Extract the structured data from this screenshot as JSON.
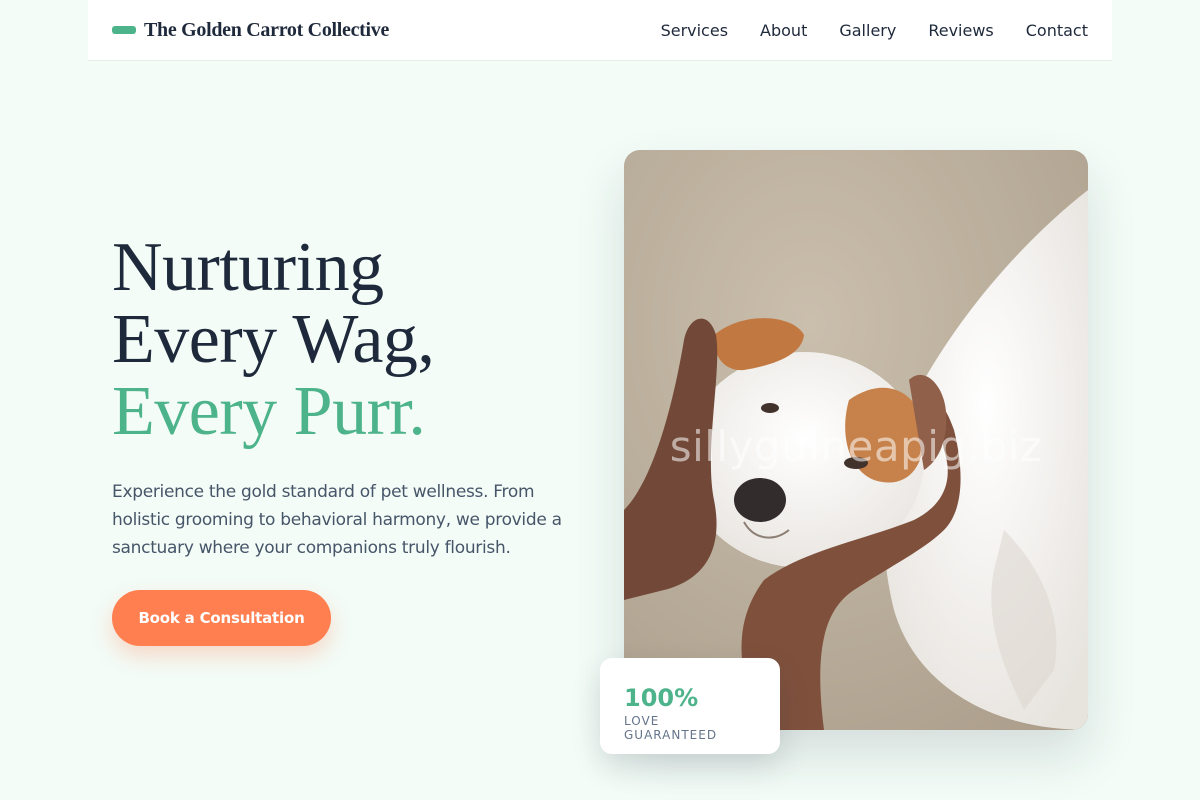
{
  "nav": {
    "brand": "The Golden Carrot Collective",
    "links": [
      "Services",
      "About",
      "Gallery",
      "Reviews",
      "Contact"
    ]
  },
  "hero": {
    "headline_line1": "Nurturing",
    "headline_line2": "Every Wag,",
    "headline_accent": "Every Purr.",
    "lede": "Experience the gold standard of pet wellness. From holistic grooming to behavioral harmony, we provide a sanctuary where your companions truly flourish.",
    "cta_label": "Book a Consultation"
  },
  "photo": {
    "watermark": "sillyguineapig.biz"
  },
  "stat": {
    "value": "100%",
    "label": "LOVE GUARANTEED"
  },
  "colors": {
    "accent": "#4db38a",
    "cta": "#ff7f50",
    "background": "#f3fcf7",
    "text": "#1e293b"
  }
}
